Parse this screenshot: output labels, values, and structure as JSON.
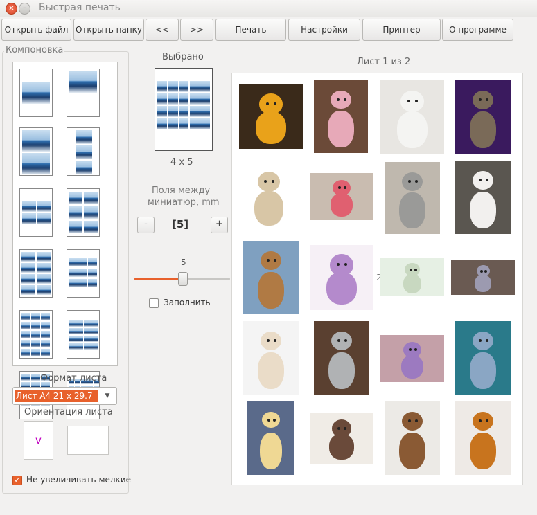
{
  "window": {
    "title": "Быстрая печать"
  },
  "toolbar": {
    "open_file": "Открыть файл",
    "open_folder": "Открыть папку",
    "prev": "<<",
    "next": ">>",
    "print": "Печать",
    "settings": "Настройки",
    "printer": "Принтер",
    "about": "О программе"
  },
  "layout_group": {
    "title": "Компоновка"
  },
  "sheet_format": {
    "label": "Формат листа",
    "value": "Лист А4 21 x 29.7"
  },
  "orientation": {
    "label": "Ориентация листа",
    "portrait_mark": "v"
  },
  "no_upscale": {
    "label": "Не увеличивать мелкие",
    "checked": true
  },
  "selected": {
    "label": "Выбрано",
    "grid": "4 x 5"
  },
  "margins": {
    "label_line1": "Поля между",
    "label_line2": "миниатюр, mm",
    "value": "[5]",
    "minus": "-",
    "plus": "+",
    "slider_value": "5"
  },
  "fill": {
    "label": "Заполнить",
    "checked": false
  },
  "sheet_page": {
    "label": "Лист 1 из 2",
    "stray_mark": "2"
  },
  "colors": {
    "accent": "#e8612c",
    "background": "#f2f1f0"
  },
  "photos": [
    {
      "name": "sun-toy-photo",
      "bg": "#3a2a1a",
      "toy": "#e9a21a"
    },
    {
      "name": "pink-bear-heart-photo",
      "bg": "#6b4a38",
      "toy": "#e7a9b8"
    },
    {
      "name": "panda-dress-photo",
      "bg": "#e8e6e2",
      "toy": "#f4f4f2"
    },
    {
      "name": "panda-collage-photo",
      "bg": "#3a1a5e",
      "toy": "#7a6a58"
    },
    {
      "name": "siamese-cat-photo",
      "bg": "#ffffff",
      "toy": "#d8c6a6"
    },
    {
      "name": "pink-bear-photo",
      "bg": "#c9bcb0",
      "toy": "#e06070"
    },
    {
      "name": "grey-bear-photo",
      "bg": "#bfb8ae",
      "toy": "#9a9a98"
    },
    {
      "name": "white-bear-photo",
      "bg": "#5a5650",
      "toy": "#f2f0ee"
    },
    {
      "name": "brown-bear-bow-photo",
      "bg": "#7fa0c0",
      "toy": "#b07a44"
    },
    {
      "name": "purple-bear-tutu-photo",
      "bg": "#f6f0f6",
      "toy": "#b48acc"
    },
    {
      "name": "mini-bears-photo",
      "bg": "#e6f0e4",
      "toy": "#c8d8c0"
    },
    {
      "name": "grey-bears-row-photo",
      "bg": "#6a5a52",
      "toy": "#9c9ab0"
    },
    {
      "name": "cream-bear-dress-photo",
      "bg": "#f4f4f4",
      "toy": "#eadcc8"
    },
    {
      "name": "grey-bear-sign-photo",
      "bg": "#5a4030",
      "toy": "#b0b2b4"
    },
    {
      "name": "purple-bears-pair-photo",
      "bg": "#c4a0a8",
      "toy": "#9c7ac0"
    },
    {
      "name": "blue-bear-photo",
      "bg": "#2a7a8a",
      "toy": "#8aa6c4"
    },
    {
      "name": "yellow-bear-photo",
      "bg": "#5a6a8a",
      "toy": "#efd894"
    },
    {
      "name": "bear-couple-photo",
      "bg": "#f0ece6",
      "toy": "#6a4a3a"
    },
    {
      "name": "brown-bear-scarf-photo",
      "bg": "#eceae6",
      "toy": "#8a5a34"
    },
    {
      "name": "ginger-bear-photo",
      "bg": "#eeeae6",
      "toy": "#c8741e"
    }
  ]
}
